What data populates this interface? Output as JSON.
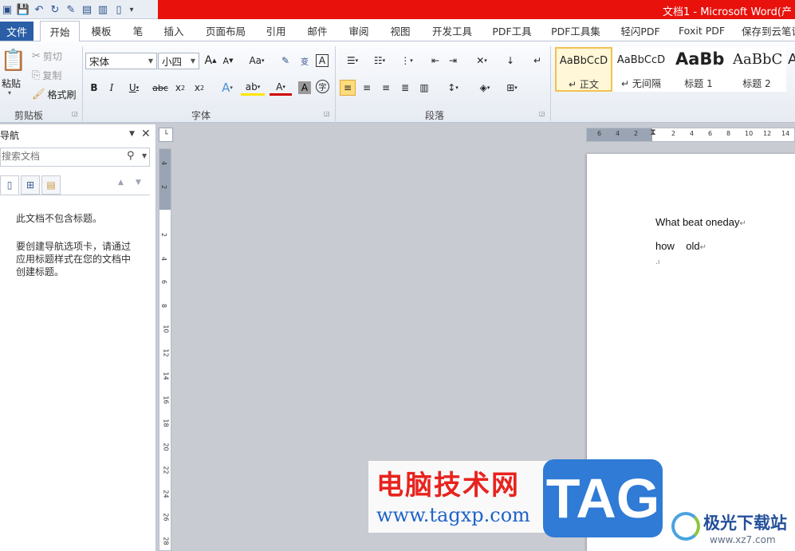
{
  "window": {
    "title": "文档1 - Microsoft Word(产"
  },
  "tabs": [
    "文件",
    "开始",
    "模板",
    "笔",
    "插入",
    "页面布局",
    "引用",
    "邮件",
    "审阅",
    "视图",
    "开发工具",
    "PDF工具",
    "PDF工具集",
    "轻闪PDF",
    "Foxit PDF",
    "保存到云笔记"
  ],
  "clipboard": {
    "paste": "粘贴",
    "cut": "剪切",
    "copy": "复制",
    "format_painter": "格式刷",
    "group": "剪贴板"
  },
  "font": {
    "name": "宋体",
    "size": "小四",
    "group": "字体",
    "change_case": "Aa",
    "grow": "A",
    "shrink": "A"
  },
  "paragraph": {
    "group": "段落"
  },
  "styles": [
    {
      "sample": "AaBbCcD",
      "name": "正文"
    },
    {
      "sample": "AaBbCcD",
      "name": "无间隔"
    },
    {
      "sample": "AaBb",
      "name": "标题 1"
    },
    {
      "sample": "AaBbC",
      "name": "标题 2"
    }
  ],
  "nav": {
    "title": "导航",
    "search_placeholder": "搜索文档",
    "msg1": "此文档不包含标题。",
    "msg2_lines": [
      "要创建导航选项卡，请通过",
      "应用标题样式在您的文档中",
      "创建标题。"
    ]
  },
  "ruler": {
    "h_ticks": [
      "6",
      "4",
      "2",
      "2",
      "4",
      "6",
      "8",
      "10",
      "12",
      "14"
    ],
    "v_ticks": [
      "4",
      "2",
      "2",
      "4",
      "6",
      "8",
      "10",
      "12",
      "14",
      "16",
      "18",
      "20",
      "22",
      "24",
      "26",
      "28"
    ]
  },
  "document": {
    "line1": "What beat oneday",
    "line2": "how    old"
  },
  "watermark": {
    "cn": "电脑技术网",
    "url": "www.tagxp.com",
    "tag": "TAG",
    "site2_cn": "极光下载站",
    "site2_url": "www.xz7.com"
  },
  "colors": {
    "title_red": "#e8110c",
    "file_tab_blue": "#2a5fa8",
    "selected_style": "#f1c250"
  }
}
